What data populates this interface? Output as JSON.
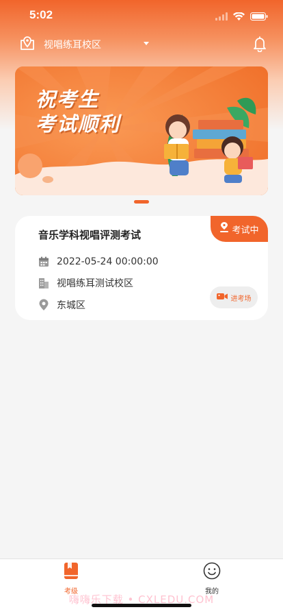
{
  "status_bar": {
    "time": "5:02"
  },
  "header": {
    "location": "视唱练耳校区"
  },
  "banner": {
    "title_line1": "祝考生",
    "title_line2": "考试顺利"
  },
  "exam": {
    "title": "音乐学科视唱评测考试",
    "status": "考试中",
    "date": "2022-05-24 00:00:00",
    "venue": "视唱练耳测试校区",
    "district": "东城区",
    "enter_label": "进考场"
  },
  "tabs": [
    {
      "label": "考级",
      "active": true
    },
    {
      "label": "我的",
      "active": false
    }
  ],
  "watermark": "嗨嗨乐下载 • CXLEDU.COM",
  "colors": {
    "accent": "#f1652b",
    "background": "#f5f5f5"
  }
}
